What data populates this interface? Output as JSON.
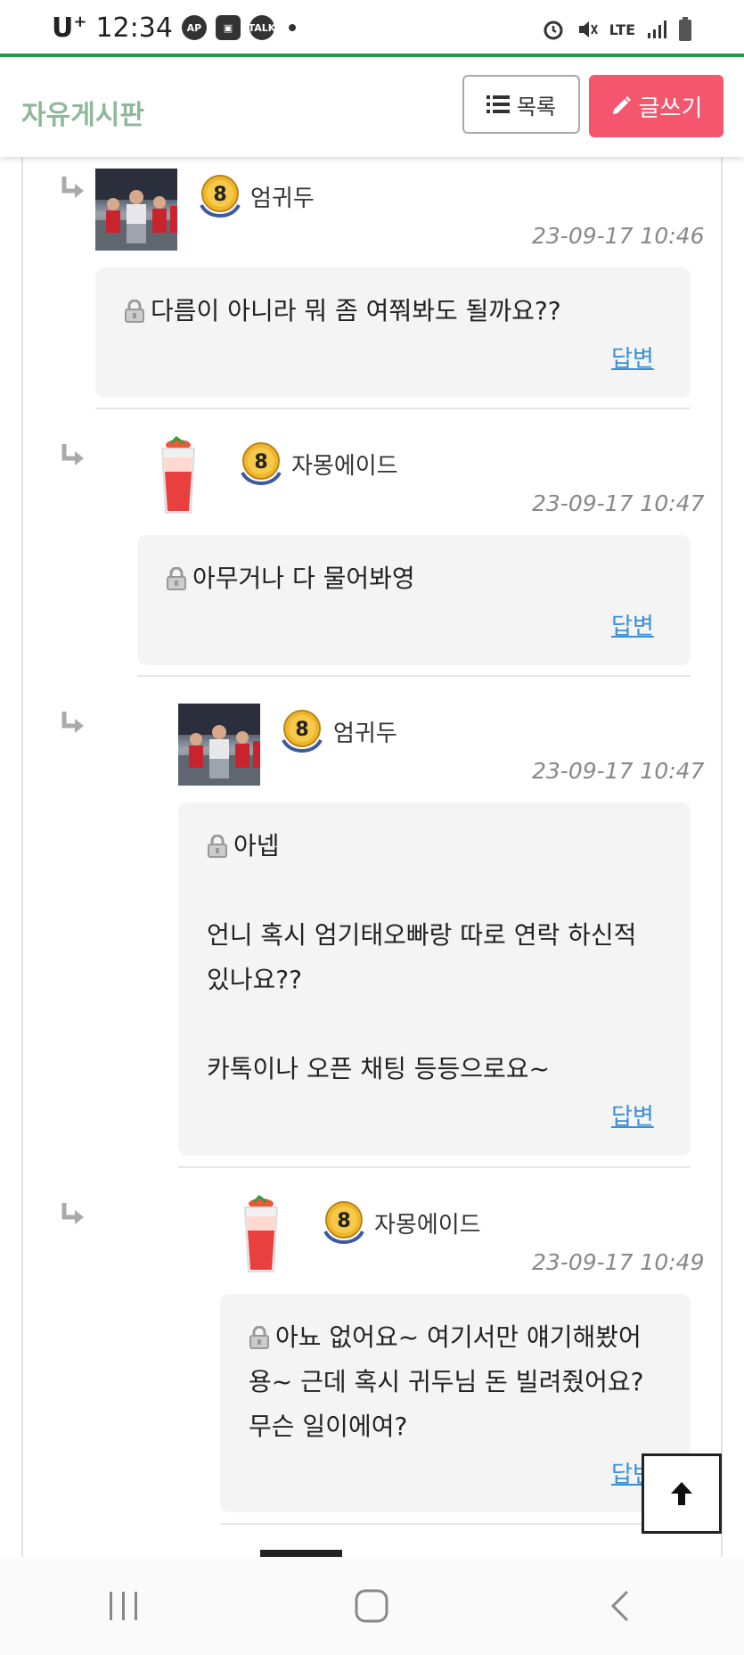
{
  "status": {
    "carrier": "U",
    "carrier_sup": "+",
    "time": "12:34",
    "net": "LTE"
  },
  "header": {
    "title": "자유게시판",
    "list_label": "목록",
    "write_label": "글쓰기"
  },
  "comments": [
    {
      "nick": "엄귀두",
      "level": "8",
      "time": "23-09-17 10:46",
      "lines": [
        "다름이 아니라 뭐 좀 여쭤봐도 될까요??"
      ],
      "reply": "답변"
    },
    {
      "nick": "자몽에이드",
      "level": "8",
      "time": "23-09-17 10:47",
      "lines": [
        "아무거나 다 물어봐영"
      ],
      "reply": "답변"
    },
    {
      "nick": "엄귀두",
      "level": "8",
      "time": "23-09-17 10:47",
      "lines": [
        "아넵",
        "",
        "언니 혹시 엄기태오빠랑 따로 연락 하신적",
        "있나요??",
        "",
        "카톡이나 오픈 채팅 등등으로요~"
      ],
      "reply": "답변"
    },
    {
      "nick": "자몽에이드",
      "level": "8",
      "time": "23-09-17 10:49",
      "lines": [
        "아뇨 없어요~ 여기서만 얘기해봤어",
        "용~ 근데 혹시 귀두님 돈 빌려줬어요?",
        "무슨 일이에여?"
      ],
      "reply": "답변"
    }
  ],
  "colors": {
    "accent_green": "#1f9a46",
    "write_button": "#f4566e",
    "link_blue": "#3a8fd6",
    "title_green": "#8fb89a"
  }
}
